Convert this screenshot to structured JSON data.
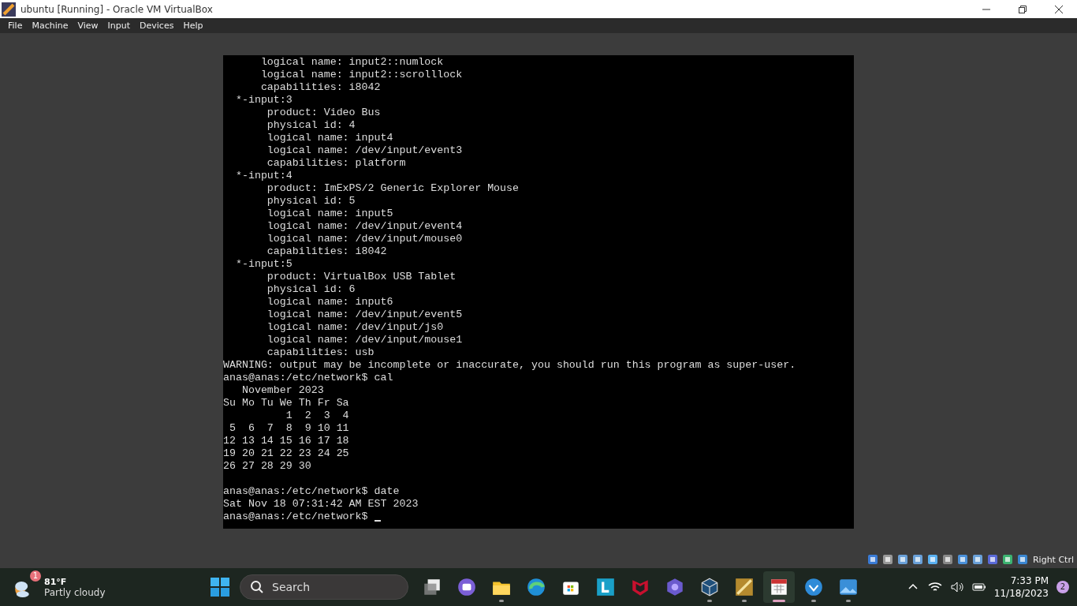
{
  "window": {
    "title": "ubuntu [Running] - Oracle VM VirtualBox"
  },
  "menu": [
    "File",
    "Machine",
    "View",
    "Input",
    "Devices",
    "Help"
  ],
  "terminal": {
    "blocks": [
      {
        "lines": [
          "      logical name: input2::numlock",
          "      logical name: input2::scrolllock",
          "      capabilities: i8042",
          "  *-input:3",
          "       product: Video Bus",
          "       physical id: 4",
          "       logical name: input4",
          "       logical name: /dev/input/event3",
          "       capabilities: platform",
          "  *-input:4",
          "       product: ImExPS/2 Generic Explorer Mouse",
          "       physical id: 5",
          "       logical name: input5",
          "       logical name: /dev/input/event4",
          "       logical name: /dev/input/mouse0",
          "       capabilities: i8042",
          "  *-input:5",
          "       product: VirtualBox USB Tablet",
          "       physical id: 6",
          "       logical name: input6",
          "       logical name: /dev/input/event5",
          "       logical name: /dev/input/js0",
          "       logical name: /dev/input/mouse1",
          "       capabilities: usb",
          "WARNING: output may be incomplete or inaccurate, you should run this program as super-user.",
          "anas@anas:/etc/network$ cal",
          "   November 2023",
          "Su Mo Tu We Th Fr Sa",
          "          1  2  3  4",
          " 5  6  7  8  9 10 11",
          "12 13 14 15 16 17 18",
          "19 20 21 22 23 24 25",
          "26 27 28 29 30"
        ]
      },
      {
        "lines": [
          "anas@anas:/etc/network$ date",
          "Sat Nov 18 07:31:42 AM EST 2023",
          "anas@anas:/etc/network$ "
        ]
      }
    ]
  },
  "status_bar": {
    "host_key": "Right Ctrl"
  },
  "taskbar": {
    "weather": {
      "temperature": "81°F",
      "condition": "Partly cloudy",
      "badge": "1"
    },
    "search": {
      "placeholder": "Search"
    },
    "apps": [
      {
        "kind": "taskview",
        "running": false,
        "selected": false
      },
      {
        "kind": "meet",
        "running": false,
        "selected": false
      },
      {
        "kind": "files",
        "running": true,
        "selected": false
      },
      {
        "kind": "browser",
        "running": false,
        "selected": false
      },
      {
        "kind": "store",
        "running": false,
        "selected": false
      },
      {
        "kind": "letter",
        "running": false,
        "selected": false
      },
      {
        "kind": "shield",
        "running": false,
        "selected": false
      },
      {
        "kind": "hexagon",
        "running": false,
        "selected": false
      },
      {
        "kind": "cube",
        "running": true,
        "selected": false
      },
      {
        "kind": "pinball",
        "running": true,
        "selected": false
      },
      {
        "kind": "calendar",
        "running": true,
        "selected": true
      },
      {
        "kind": "circle",
        "running": true,
        "selected": false
      },
      {
        "kind": "photos",
        "running": true,
        "selected": false
      }
    ],
    "clock": {
      "time": "7:33 PM",
      "date": "11/18/2023"
    },
    "notifications": "2"
  }
}
